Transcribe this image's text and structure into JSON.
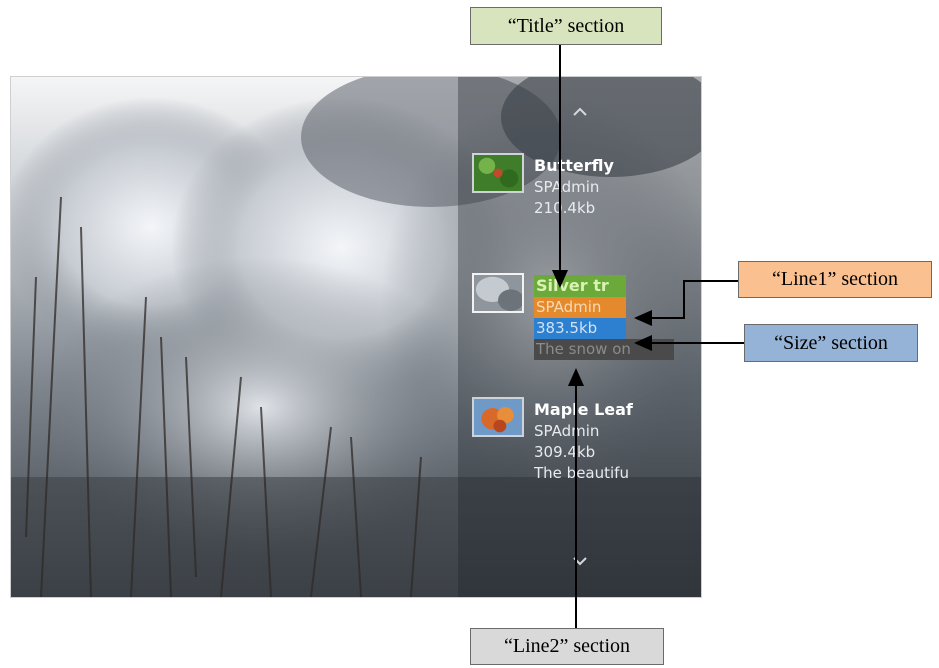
{
  "callouts": {
    "title": "“Title” section",
    "line1": "“Line1” section",
    "size": "“Size” section",
    "line2": "“Line2” section"
  },
  "colors": {
    "title_callout": "#d7e4bd",
    "line1_callout": "#fac090",
    "size_callout": "#95b3d7",
    "line2_callout": "#d9d9d9",
    "title_highlight": "#6aa93a",
    "line1_highlight": "#e58a2c",
    "size_highlight": "#2d7fd0",
    "line2_highlight": "#4a4a4a"
  },
  "slider": {
    "up_arrow": "˄",
    "down_arrow": "˅",
    "items": [
      {
        "title": "Butterfly",
        "line1": "SPAdmin",
        "size": "210.4kb",
        "line2": ""
      },
      {
        "title": "Silver tr",
        "line1": "SPAdmin",
        "size": "383.5kb",
        "line2": "The snow on"
      },
      {
        "title": "Maple Leaf",
        "line1": "SPAdmin",
        "size": "309.4kb",
        "line2": "The beautifu"
      }
    ]
  }
}
